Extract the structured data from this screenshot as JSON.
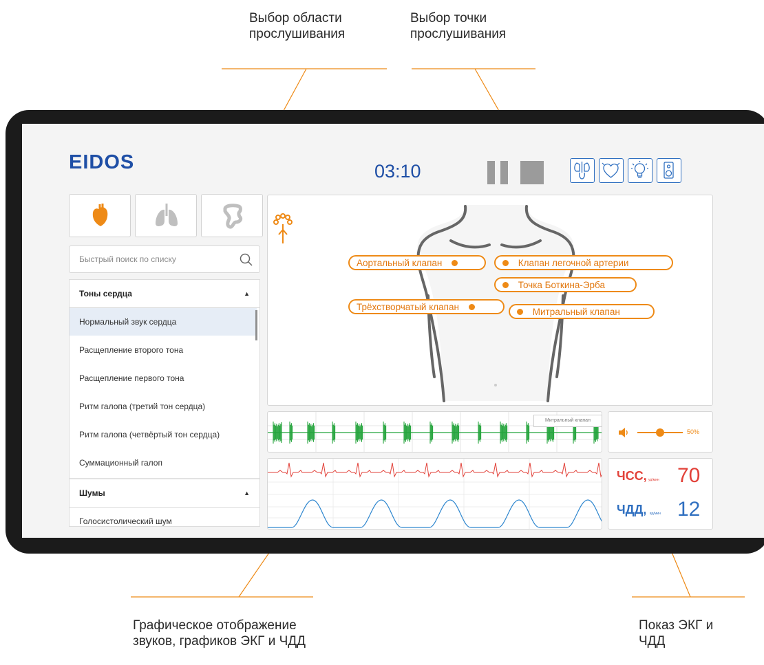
{
  "callouts": {
    "area": "Выбор области прослушивания",
    "point": "Выбор точки прослушивания",
    "graphics": "Графическое отображение звуков, графиков ЭКГ и ЧДД",
    "vitals": "Показ ЭКГ и ЧДД"
  },
  "header": {
    "logo": "EIDOS",
    "timer": "03:10"
  },
  "top_icons": [
    "lungs-body-icon",
    "heart-icon",
    "lightbulb-icon",
    "speaker-icon"
  ],
  "categories": [
    "heart-icon",
    "lungs-icon",
    "intestine-icon"
  ],
  "search": {
    "placeholder": "Быстрый поиск по списку"
  },
  "list": {
    "section1": "Тоны сердца",
    "items": [
      "Нормальный звук сердца",
      "Расщепление второго тона",
      "Расщепление первого тона",
      "Ритм галопа (третий тон сердца)",
      "Ритм галопа (четвёртый тон сердца)",
      "Суммационный галоп"
    ],
    "section2": "Шумы",
    "section2_items": [
      "Голосистолический шум"
    ]
  },
  "points": {
    "aortic": "Аортальный клапан",
    "pulmonary": "Клапан легочной артерии",
    "botkin": "Точка Боткина-Эрба",
    "tricuspid": "Трёхстворчатый клапан",
    "mitral": "Митральный клапан"
  },
  "sound_graph": {
    "tooltip": "Митральный клапан"
  },
  "volume": {
    "value": 50,
    "label": "50%"
  },
  "vitals": {
    "hr_label": "ЧСС,",
    "hr_unit": "уд/мин",
    "hr_value": "70",
    "rr_label": "ЧДД,",
    "rr_unit": "вд/мин",
    "rr_value": "12"
  },
  "colors": {
    "brand_blue": "#1f4fa6",
    "accent_orange": "#ee8a16",
    "ecg_green": "#22a33a",
    "ecg_red": "#e2423a",
    "resp_blue": "#2f87cf"
  }
}
